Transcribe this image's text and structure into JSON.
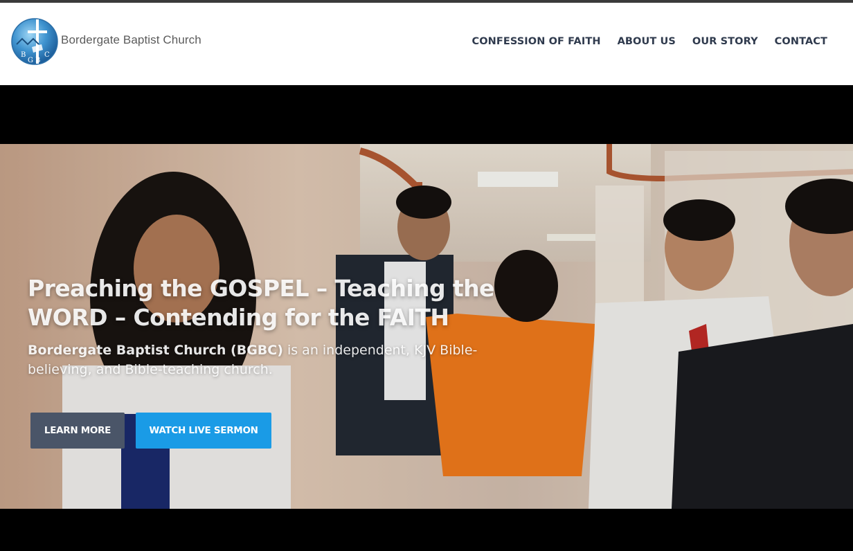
{
  "site": {
    "name": "Bordergate Baptist Church",
    "logo_letters": [
      "B",
      "G",
      "B",
      "C"
    ]
  },
  "nav": {
    "items": [
      {
        "label": "CONFESSION OF FAITH"
      },
      {
        "label": "ABOUT US"
      },
      {
        "label": "OUR STORY"
      },
      {
        "label": "CONTACT"
      }
    ]
  },
  "hero": {
    "headline_line1": "Preaching the GOSPEL – Teaching the",
    "headline_line2": "WORD – Contending for the FAITH",
    "sub_bold": "Bordergate Baptist Church (BGBC)",
    "sub_rest": " is an independent, KJV Bible-believing, and Bible-teaching church.",
    "buttons": {
      "learn_more": "LEARN MORE",
      "watch_live": "WATCH LIVE SERMON"
    }
  },
  "colors": {
    "nav_text": "#2f3a4d",
    "learn_button": "#4a5568",
    "watch_button": "#1a9be6"
  }
}
